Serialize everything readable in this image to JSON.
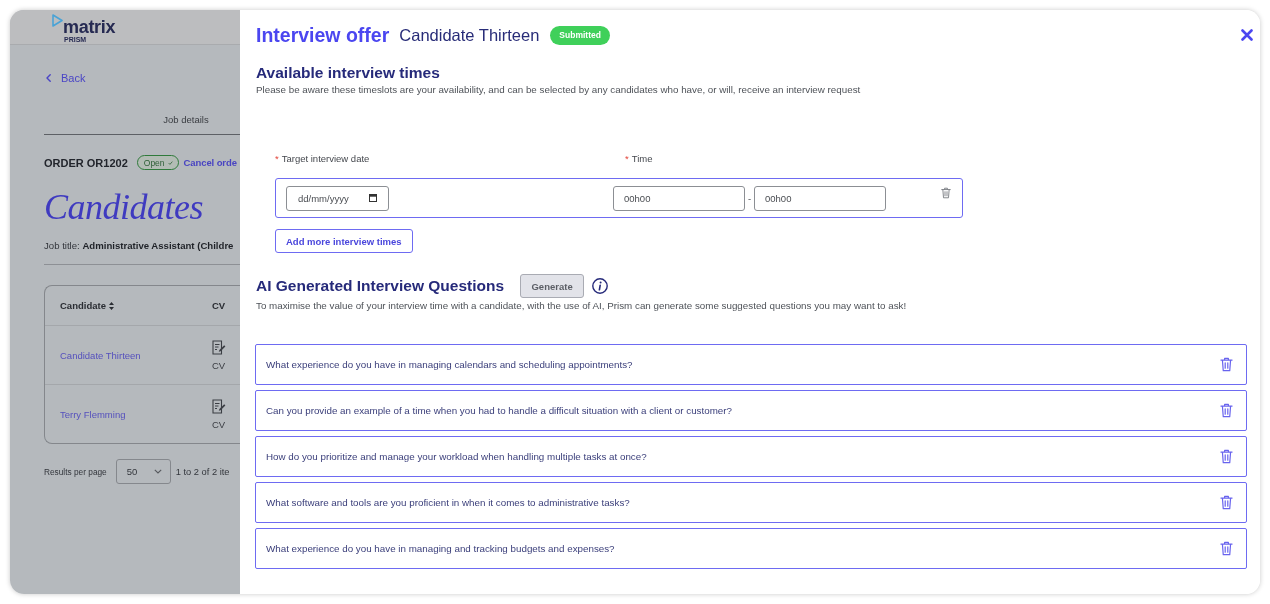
{
  "background_page": {
    "logo": {
      "name": "matrix",
      "tagline": "PRISM"
    },
    "back_link": "Back",
    "tabs": [
      {
        "label": "Job details",
        "selected": true
      }
    ],
    "order": {
      "title": "ORDER OR1202",
      "status": "Open",
      "cancel_link": "Cancel orde"
    },
    "heading": "Candidates",
    "job_title": "Job title: **Administrative Assistant (Childre**",
    "table": {
      "columns": [
        "Candidate",
        "CV"
      ],
      "rows": [
        {
          "candidate": "Candidate Thirteen",
          "cv": "CV"
        },
        {
          "candidate": "Terry Flemming",
          "cv": "CV"
        }
      ]
    },
    "pagination": {
      "label": "Results per page",
      "page_size": "50",
      "range": "1 to 2 of 2 ite"
    }
  },
  "panel": {
    "title": "Interview offer",
    "candidate": "Candidate Thirteen",
    "status": "Submitted",
    "availability": {
      "heading": "Available interview times",
      "note": "Please be aware these timeslots are your availability, and can be selected by any candidates who have, or will, receive an interview request",
      "fields": [
        {
          "label": "Target interview date",
          "marker": "*"
        },
        {
          "label": "Time",
          "marker": "*"
        }
      ],
      "slots": [
        {
          "date": {
            "placeholder": "dd/mm/yyyy"
          },
          "start": {
            "placeholder": "00h00"
          },
          "separator": "-",
          "end": {
            "placeholder": "00h00"
          }
        }
      ],
      "add_button": "Add more interview times"
    },
    "questions": {
      "heading": "AI Generated Interview Questions",
      "generate_button": {
        "label": "Generate",
        "disabled": true
      },
      "note": "To maximise the value of your interview time with a candidate, with the use of AI, Prism can generate some suggested questions you may want to ask!",
      "items": [
        "What experience do you have in managing calendars and scheduling appointments?",
        "Can you provide an example of a time when you had to handle a difficult situation with a client or customer?",
        "How do you prioritize and manage your workload when handling multiple tasks at once?",
        "What software and tools are you proficient in when it comes to administrative tasks?",
        "What experience do you have in managing and tracking budgets and expenses?"
      ]
    }
  }
}
